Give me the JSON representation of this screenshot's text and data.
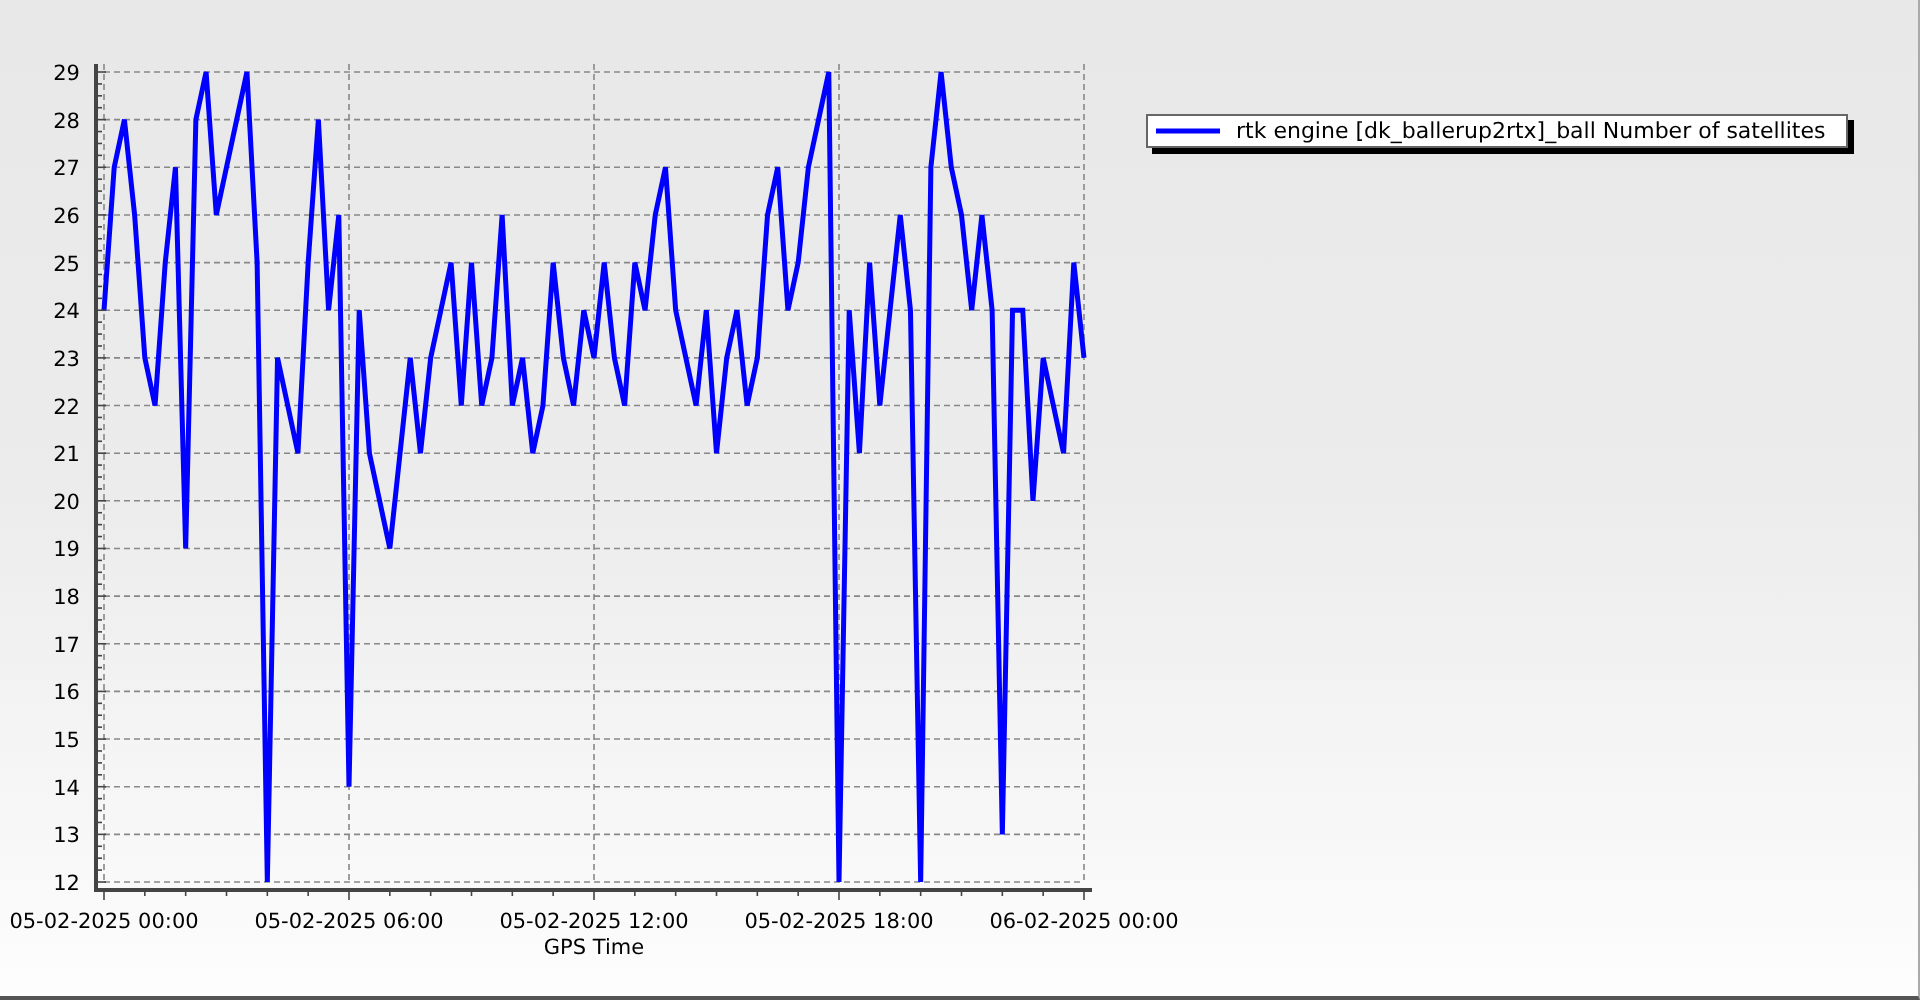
{
  "chart": {
    "chart_data": {
      "type": "line",
      "grid": true,
      "xlabel": "GPS Time",
      "ylim": [
        12,
        29
      ],
      "categories": [
        "05-02-2025 00:00",
        null,
        null,
        null,
        null,
        null,
        null,
        null,
        null,
        null,
        null,
        null,
        null,
        null,
        null,
        null,
        null,
        null,
        null,
        null,
        null,
        null,
        null,
        null,
        "05-02-2025 06:00",
        null,
        null,
        null,
        null,
        null,
        null,
        null,
        null,
        null,
        null,
        null,
        null,
        null,
        null,
        null,
        null,
        null,
        null,
        null,
        null,
        null,
        null,
        null,
        "05-02-2025 12:00",
        null,
        null,
        null,
        null,
        null,
        null,
        null,
        null,
        null,
        null,
        null,
        null,
        null,
        null,
        null,
        null,
        null,
        null,
        null,
        null,
        null,
        null,
        null,
        "05-02-2025 18:00",
        null,
        null,
        null,
        null,
        null,
        null,
        null,
        null,
        null,
        null,
        null,
        null,
        null,
        null,
        null,
        null,
        null,
        null,
        null,
        null,
        null,
        null,
        null,
        "06-02-2025 00:00"
      ],
      "series": [
        {
          "name": "rtk engine [dk_ballerup2rtx]_ball Number of satellites",
          "color": "#0000ff",
          "values": [
            24,
            27,
            28,
            26,
            23,
            22,
            25,
            27,
            19,
            28,
            29,
            26,
            27,
            28,
            29,
            25,
            12,
            23,
            22,
            21,
            25,
            28,
            24,
            26,
            14,
            24,
            21,
            20,
            19,
            21,
            23,
            21,
            23,
            24,
            25,
            22,
            25,
            22,
            23,
            26,
            22,
            23,
            21,
            22,
            25,
            23,
            22,
            24,
            23,
            25,
            23,
            22,
            25,
            24,
            26,
            27,
            24,
            23,
            22,
            24,
            21,
            23,
            24,
            22,
            23,
            26,
            27,
            24,
            25,
            27,
            28,
            29,
            12,
            24,
            21,
            25,
            22,
            24,
            26,
            24,
            12,
            27,
            29,
            27,
            26,
            24,
            26,
            24,
            13,
            24,
            24,
            20,
            23,
            22,
            21,
            25,
            23
          ]
        }
      ],
      "yticks": [
        12,
        13,
        14,
        15,
        16,
        17,
        18,
        19,
        20,
        21,
        22,
        23,
        24,
        25,
        26,
        27,
        28,
        29
      ]
    }
  }
}
